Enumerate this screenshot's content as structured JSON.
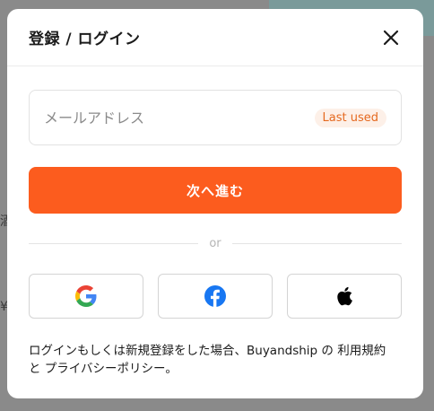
{
  "modal": {
    "title": "登録 / ログイン",
    "email_placeholder": "メールアドレス",
    "last_used_badge": "Last used",
    "continue_label": "次へ進む",
    "divider_text": "or",
    "social_buttons": [
      {
        "icon": "google-icon"
      },
      {
        "icon": "facebook-icon"
      },
      {
        "icon": "apple-icon"
      }
    ],
    "terms": {
      "prefix": "ログインもしくは新規登録をした場合、Buyandship の",
      "terms_link": "利用規約",
      "connector": "と",
      "privacy_link": "プライバシーポリシー",
      "suffix": "。"
    }
  },
  "colors": {
    "accent": "#fc5c1e",
    "badge_text": "#e5691f",
    "badge_bg": "#fdf0e8",
    "facebook": "#1877f2"
  },
  "background": {
    "edge_text_1": "酒",
    "edge_text_2": "¥"
  }
}
